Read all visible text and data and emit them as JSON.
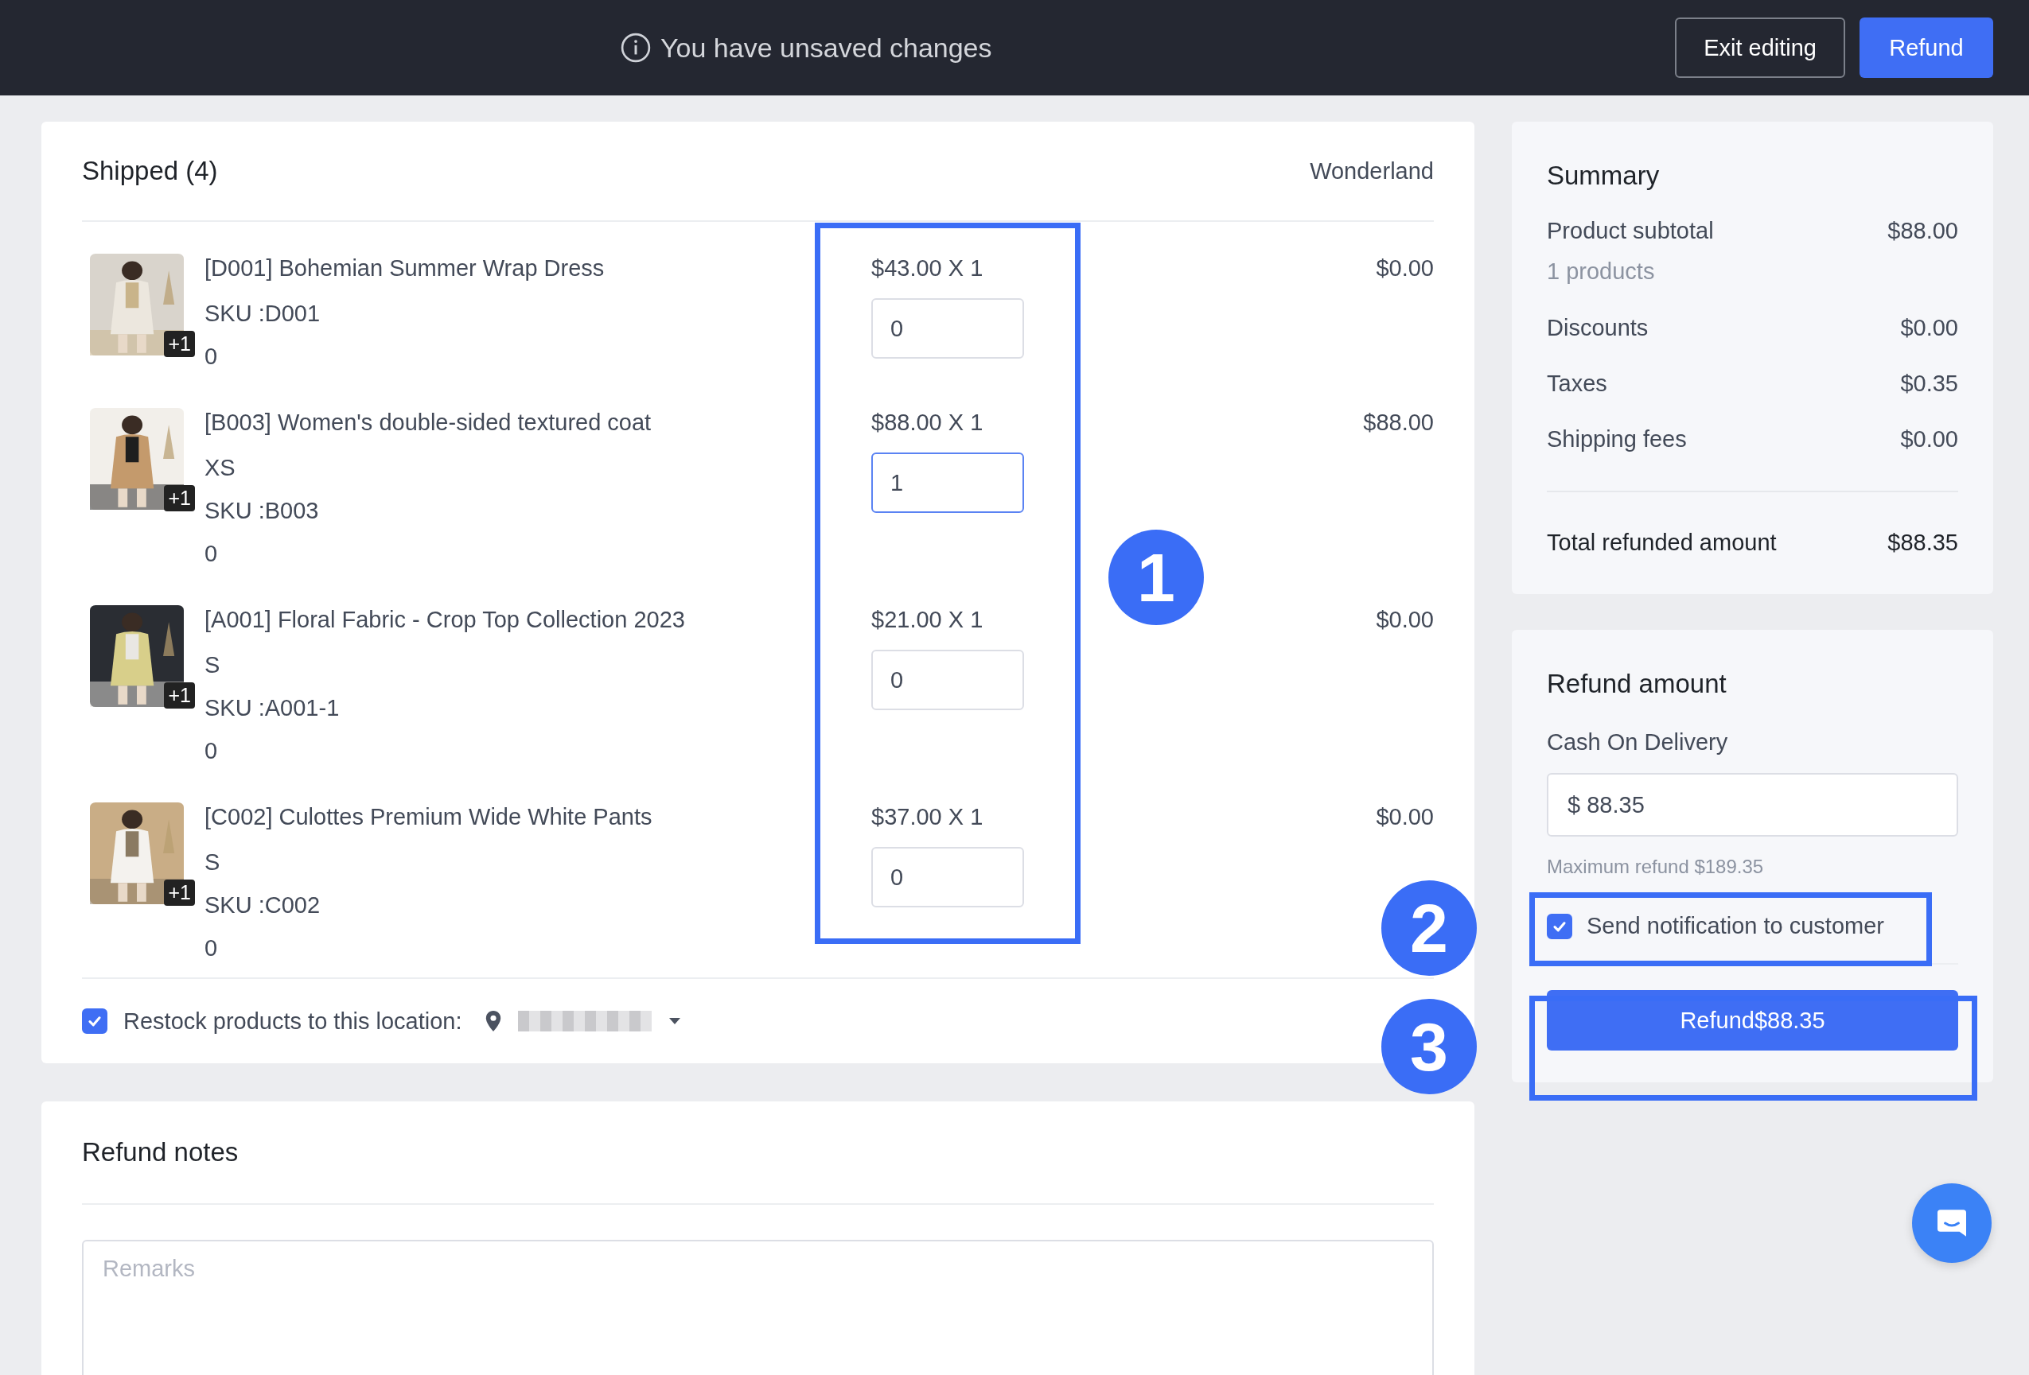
{
  "topbar": {
    "notice": "You have unsaved changes",
    "buttons": [
      {
        "label": "Exit editing",
        "kind": "secondary"
      },
      {
        "label": "Refund",
        "kind": "primary"
      }
    ]
  },
  "shipped": {
    "title": "Shipped (4)",
    "location": "Wonderland",
    "items": [
      {
        "name": "[D001] Bohemian Summer Wrap Dress",
        "sku": "SKU :D001",
        "count": "0",
        "badge": "+1",
        "unit_price": "$43.00 X 1",
        "quantity": "0",
        "focused": false,
        "total": "$0.00"
      },
      {
        "name": "[B003] Women's double-sided textured coat",
        "variant": "XS",
        "sku": "SKU :B003",
        "count": "0",
        "badge": "+1",
        "unit_price": "$88.00 X 1",
        "quantity": "1",
        "focused": true,
        "total": "$88.00"
      },
      {
        "name": "[A001] Floral Fabric - Crop Top Collection 2023",
        "variant": "S",
        "sku": "SKU :A001-1",
        "count": "0",
        "badge": "+1",
        "unit_price": "$21.00 X 1",
        "quantity": "0",
        "focused": false,
        "total": "$0.00"
      },
      {
        "name": "[C002] Culottes Premium Wide White Pants",
        "variant": "S",
        "sku": "SKU :C002",
        "count": "0",
        "badge": "+1",
        "unit_price": "$37.00 X 1",
        "quantity": "0",
        "focused": false,
        "total": "$0.00"
      }
    ],
    "restock": {
      "label": "Restock products to this location:",
      "checked": true
    }
  },
  "notes": {
    "title": "Refund notes",
    "placeholder": "Remarks"
  },
  "summary": {
    "title": "Summary",
    "rows": [
      {
        "label": "Product subtotal",
        "value": "$88.00",
        "note": "1 products"
      },
      {
        "label": "Discounts",
        "value": "$0.00"
      },
      {
        "label": "Taxes",
        "value": "$0.35"
      },
      {
        "label": "Shipping fees",
        "value": "$0.00"
      }
    ],
    "total": {
      "label": "Total refunded amount",
      "value": "$88.35"
    }
  },
  "refund": {
    "title": "Refund amount",
    "method": "Cash On Delivery",
    "amount": "$ 88.35",
    "max_note": "Maximum refund $189.35",
    "notify": {
      "label": "Send notification to customer",
      "checked": true
    },
    "button": "Refund$88.35"
  },
  "annotations": [
    {
      "label": "1"
    },
    {
      "label": "2"
    },
    {
      "label": "3"
    }
  ]
}
